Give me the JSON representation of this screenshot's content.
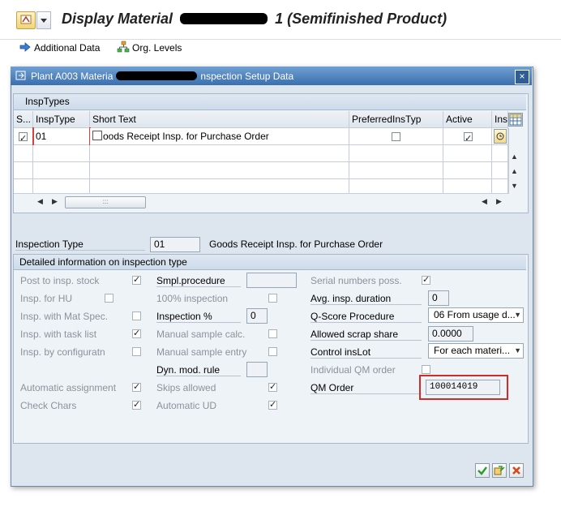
{
  "window": {
    "title_prefix": "Display Material",
    "title_suffix": "1 (Semifinished Product)"
  },
  "toolbar": {
    "additional_data": "Additional Data",
    "org_levels": "Org. Levels"
  },
  "dialog": {
    "title_prefix": "Plant A003 Materia",
    "title_suffix": "nspection Setup Data",
    "close": "×"
  },
  "insp_types": {
    "group_title": "InspTypes",
    "columns": [
      "S...",
      "InspType",
      "Short Text",
      "PreferredInsTyp",
      "Active",
      "Ins"
    ],
    "rows": [
      {
        "selected": true,
        "insp_type": "01",
        "short_text": "oods Receipt Insp. for Purchase Order",
        "preferred": false,
        "active": true
      }
    ]
  },
  "inspection_type": {
    "label": "Inspection Type",
    "value": "01",
    "description": "Goods Receipt Insp. for Purchase Order"
  },
  "detail": {
    "group_title": "Detailed information on inspection type",
    "col1": [
      {
        "label": "Post to insp. stock",
        "checked": true
      },
      {
        "label": "Insp. for HU",
        "checked": false
      },
      {
        "label": "Insp. with Mat Spec.",
        "checked": false
      },
      {
        "label": "Insp. with task list",
        "checked": true
      },
      {
        "label": "Insp. by configuratn",
        "checked": false
      },
      {
        "label": "Automatic assignment",
        "checked": true
      },
      {
        "label": "Check Chars",
        "checked": true
      }
    ],
    "col2": {
      "smpl_procedure": {
        "label": "Smpl.procedure",
        "value": ""
      },
      "pct_inspection": {
        "label": "100% inspection",
        "checked": false
      },
      "inspection_pct": {
        "label": "Inspection %",
        "value": "0"
      },
      "manual_sample_calc": {
        "label": "Manual sample calc.",
        "checked": false
      },
      "manual_sample_entry": {
        "label": "Manual sample entry",
        "checked": false
      },
      "dyn_mod_rule": {
        "label": "Dyn. mod. rule",
        "value": ""
      },
      "skips_allowed": {
        "label": "Skips allowed",
        "checked": true
      },
      "automatic_ud": {
        "label": "Automatic UD",
        "checked": true
      }
    },
    "col3": {
      "serial_numbers": {
        "label": "Serial numbers poss.",
        "checked": true
      },
      "avg_duration": {
        "label": "Avg. insp. duration",
        "value": "0"
      },
      "qscore_procedure": {
        "label": "Q-Score Procedure",
        "value": "06 From usage d..."
      },
      "allowed_scrap": {
        "label": "Allowed scrap share",
        "value": "0.0000"
      },
      "control_inslot": {
        "label": "Control insLot",
        "value": "For each materi..."
      },
      "individual_qm_order": {
        "label": "Individual QM order",
        "checked": false
      },
      "qm_order": {
        "label": "QM Order",
        "value": "100014019"
      }
    }
  },
  "colors": {
    "title_gradient_top": "#6f9fd3",
    "title_gradient_bottom": "#3b6fae",
    "highlight": "#d32a2a",
    "confirm_green": "#2e9a2e",
    "cancel_red": "#d34a1e"
  }
}
